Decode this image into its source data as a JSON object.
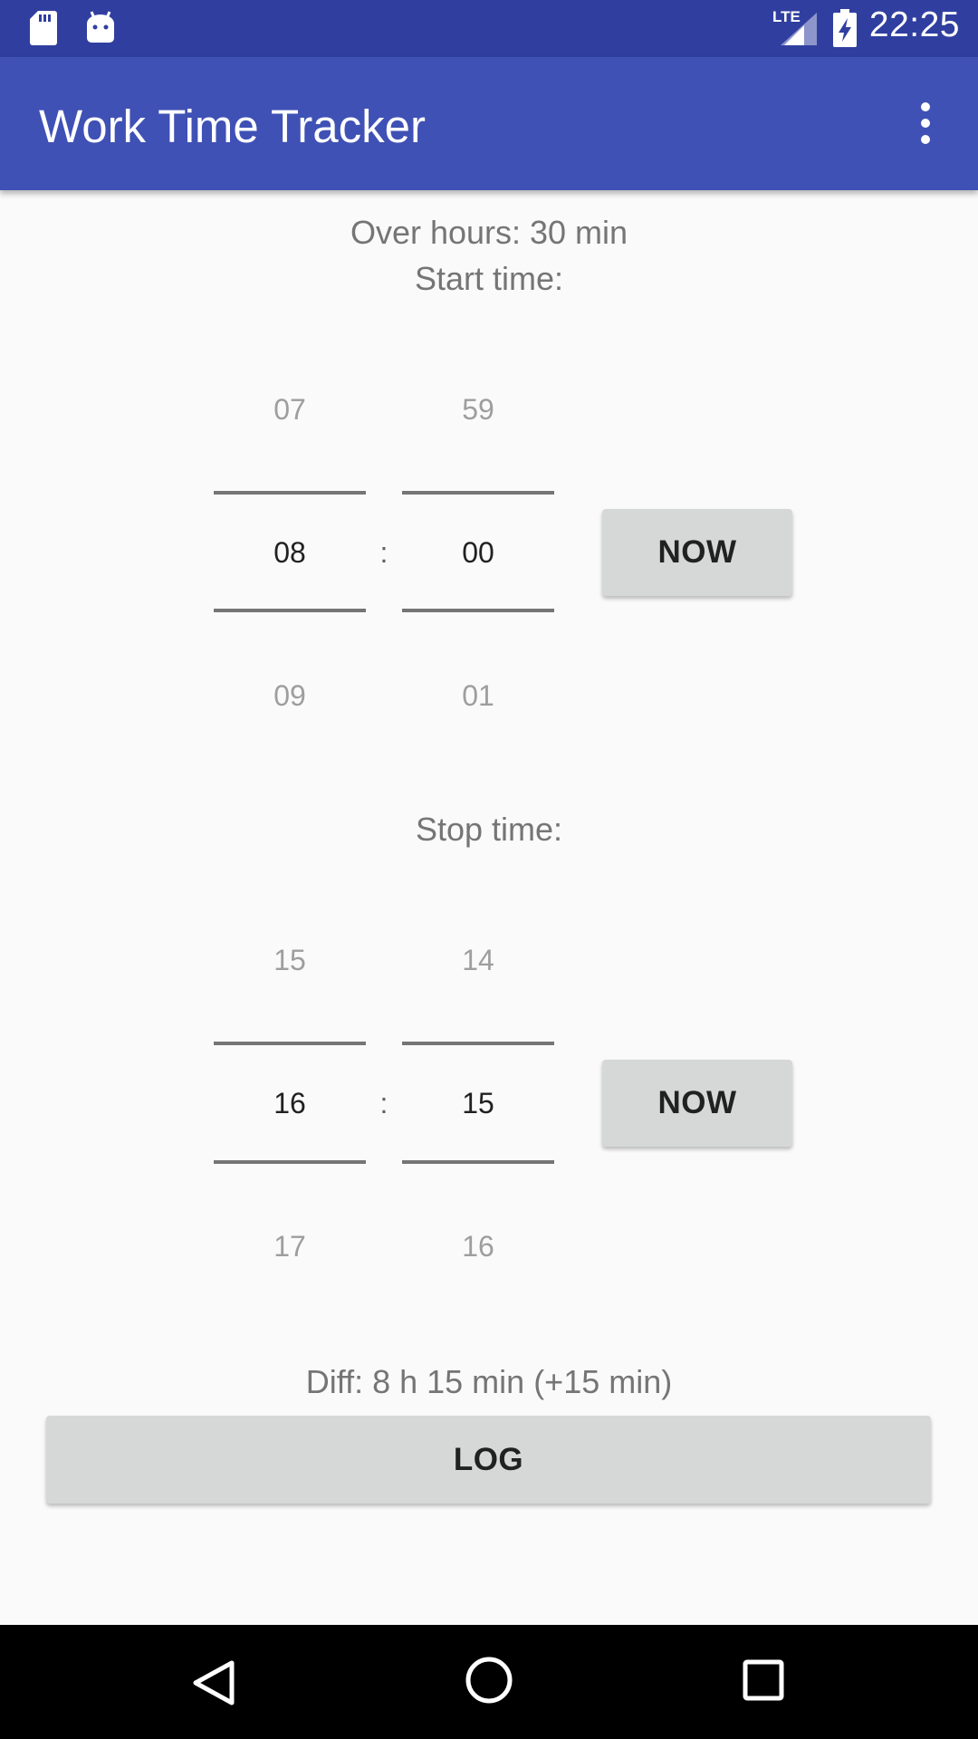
{
  "status_bar": {
    "time": "22:25",
    "network": "LTE",
    "icons": [
      "sd-card-icon",
      "android-icon",
      "lte-signal-icon",
      "battery-charging-icon"
    ]
  },
  "app_bar": {
    "title": "Work Time Tracker",
    "menu_icon": "more-vert-icon"
  },
  "main": {
    "over_hours": "Over hours: 30 min",
    "start_label": "Start time:",
    "start_picker": {
      "hour_prev": "07",
      "hour": "08",
      "hour_next": "09",
      "separator": ":",
      "minute_prev": "59",
      "minute": "00",
      "minute_next": "01"
    },
    "start_now_button": "NOW",
    "stop_label": "Stop time:",
    "stop_picker": {
      "hour_prev": "15",
      "hour": "16",
      "hour_next": "17",
      "separator": ":",
      "minute_prev": "14",
      "minute": "15",
      "minute_next": "16"
    },
    "stop_now_button": "NOW",
    "diff": "Diff: 8 h 15 min (+15 min)",
    "log_button": "LOG"
  },
  "nav_bar": {
    "icons": [
      "back-icon",
      "home-icon",
      "recents-icon"
    ]
  },
  "colors": {
    "status_bar": "#303f9f",
    "app_bar": "#3f51b5",
    "background": "#fafafa",
    "button": "#d6d7d7"
  }
}
